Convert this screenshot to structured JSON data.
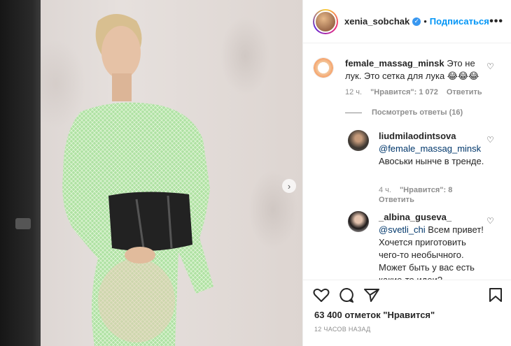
{
  "post": {
    "username": "xenia_sobchak",
    "follow_label": "Подписаться",
    "dot": "•",
    "more": "•••",
    "likes_text": "63 400 отметок \"Нравится\"",
    "time_ago": "12 ЧАСОВ НАЗАД"
  },
  "comments": [
    {
      "user": "female_massag_minsk",
      "text": "Это не лук. Это сетка для лука 😂😂😂",
      "time": "12 ч.",
      "likes": "\"Нравится\": 1 072",
      "reply": "Ответить"
    },
    {
      "user": "liudmilaodintsova",
      "mention": "@female_massag_minsk",
      "text": "Авоськи нынче в тренде.",
      "time": "4 ч.",
      "likes": "\"Нравится\": 8",
      "reply": "Ответить"
    },
    {
      "user": "_albina_guseva_",
      "mention": "@svetli_chi",
      "text": "Всем привет! Хочется приготовить чего-то необычного. Может быть у вас есть какие-то идеи?"
    }
  ],
  "view_replies": "Посмотреть ответы (16)",
  "icons": {
    "next": "chevron-right-icon",
    "like": "heart-icon",
    "comment": "speech-bubble-icon",
    "share": "paper-plane-icon",
    "save": "bookmark-icon"
  },
  "colors": {
    "accent": "#0095f6",
    "verified": "#3897f0",
    "dress": "#a6e39a"
  }
}
